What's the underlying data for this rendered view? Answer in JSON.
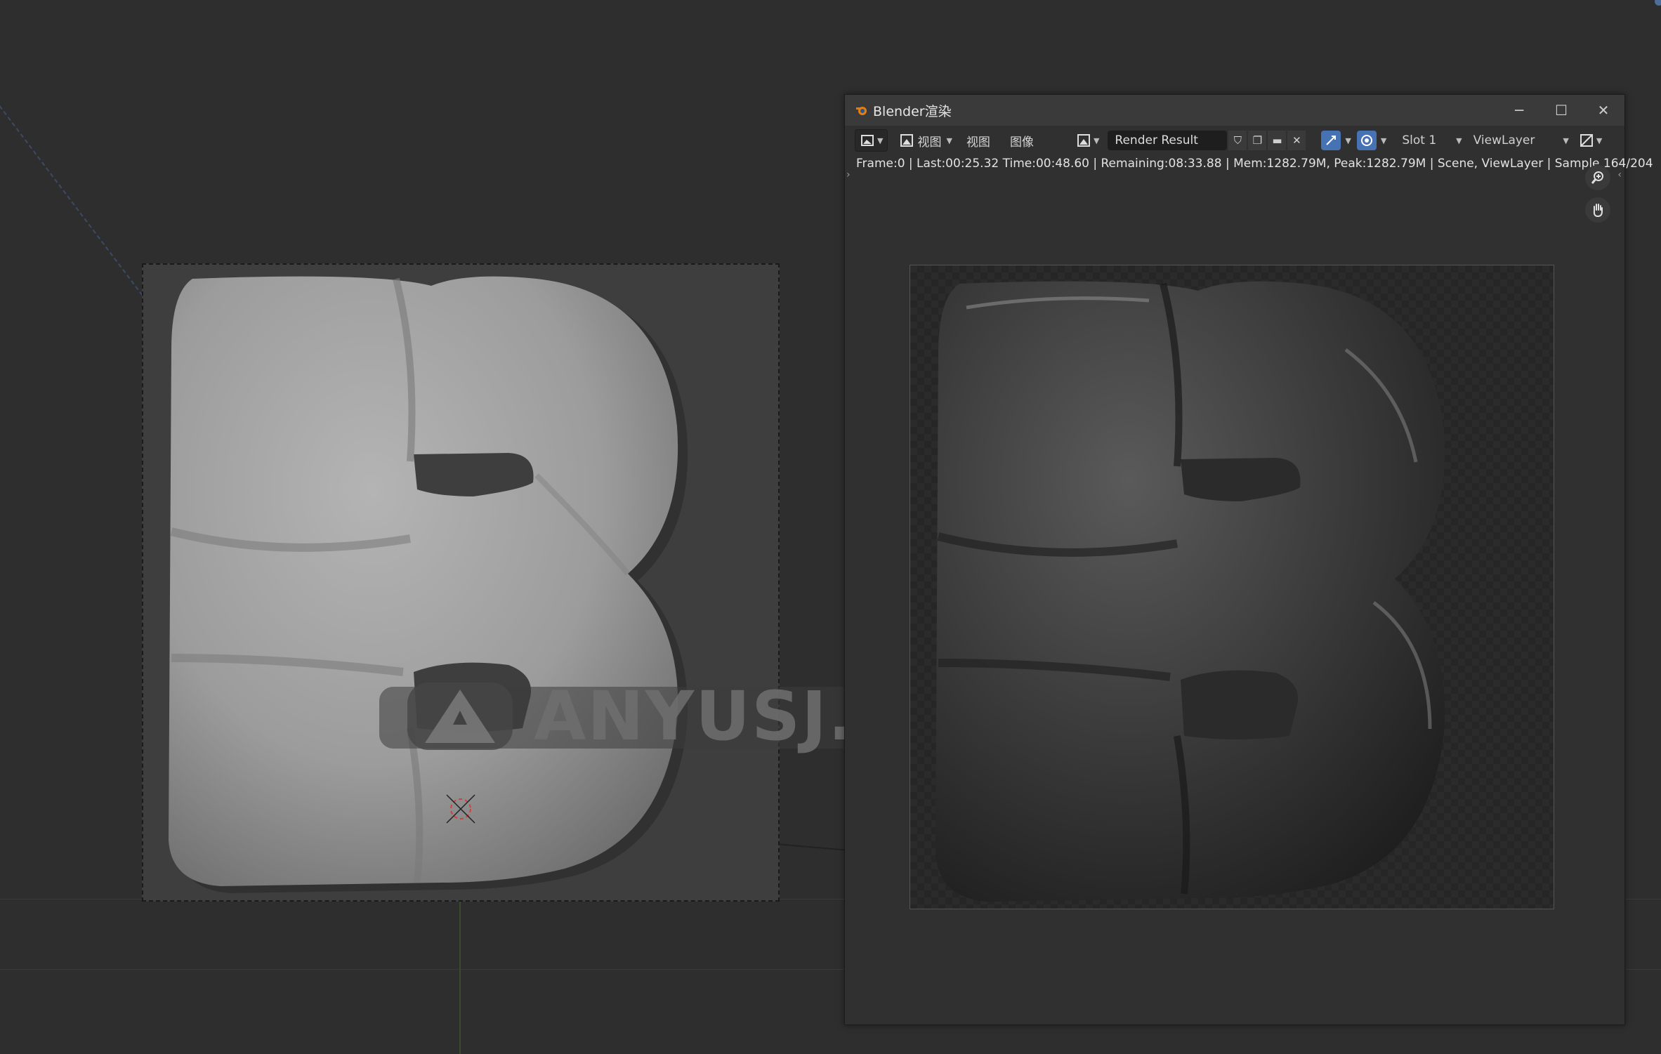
{
  "window": {
    "title": "Blender渲染",
    "minimize": "─",
    "maximize": "☐",
    "close": "✕"
  },
  "toolbar": {
    "view_menu_1": "视图",
    "view_menu_2": "视图",
    "image_menu": "图像",
    "image_name": "Render Result",
    "slot": "Slot 1",
    "view_layer": "ViewLayer"
  },
  "status": {
    "text": "Frame:0 | Last:00:25.32 Time:00:48.60 | Remaining:08:33.88 | Mem:1282.79M, Peak:1282.79M | Scene, ViewLayer | Sample 164/204"
  },
  "watermark": {
    "text": "ANYUSJ.COM®"
  },
  "colors": {
    "accent_blue": "#4772b3",
    "blender_orange": "#e87d0d",
    "viewport_bg": "#2d2d2d",
    "clay_gray": "#9a9a9a",
    "render_dark": "#3a3a3a"
  }
}
